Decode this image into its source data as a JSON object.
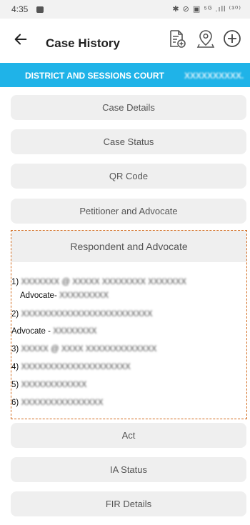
{
  "status": {
    "time": "4:35",
    "right_icons": "✱ ⊘ ▣ ⁵ᴳ .ıll ⁽³⁰⁾"
  },
  "header": {
    "title": "Case History",
    "icons": [
      "back-icon",
      "document-add-icon",
      "location-pin-icon",
      "add-circle-icon"
    ]
  },
  "banner": {
    "text": "DISTRICT AND SESSIONS COURT",
    "blurred_suffix": "XXXXXXXXXX."
  },
  "sections": {
    "case_details": "Case Details",
    "case_status": "Case Status",
    "qr_code": "QR Code",
    "petitioner": "Petitioner and Advocate",
    "respondent": "Respondent and Advocate",
    "act": "Act",
    "ia_status": "IA Status",
    "fir_details": "FIR Details"
  },
  "respondents": {
    "r1_prefix": "1)",
    "r1_blur": "XXXXXXX @ XXXXX XXXXXXXX XXXXXXX",
    "r1_adv_prefix": "Advocate-",
    "r1_adv_blur": "XXXXXXXXX",
    "r2_prefix": "2)",
    "r2_blur": "XXXXXXXXXXXXXXXXXXXXXXXX",
    "r2_adv_prefix": "Advocate -",
    "r2_adv_blur": "XXXXXXXX",
    "r3_prefix": "3)",
    "r3_blur": "XXXXX @ XXXX XXXXXXXXXXXXX",
    "r4_prefix": "4)",
    "r4_blur": "XXXXXXXXXXXXXXXXXXXX",
    "r5_prefix": "5)",
    "r5_blur": "XXXXXXXXXXXX",
    "r6_prefix": "6)",
    "r6_blur": "XXXXXXXXXXXXXXX"
  },
  "colors": {
    "banner": "#1fb3e8",
    "highlight_border": "#d26b1d",
    "section_bg": "#efefef"
  }
}
